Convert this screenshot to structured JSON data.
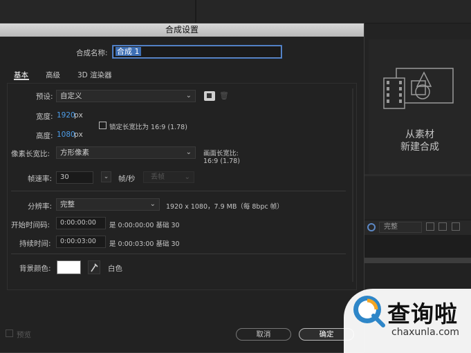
{
  "background": {
    "from_footage_line1": "从素材",
    "from_footage_line2": "新建合成",
    "quality": "完整"
  },
  "dialog": {
    "title": "合成设置",
    "name_label": "合成名称:",
    "name_value": "合成 1",
    "tabs": [
      "基本",
      "高级",
      "3D 渲染器"
    ],
    "preset_label": "预设:",
    "preset_value": "自定义",
    "width_label": "宽度:",
    "width_value": "1920",
    "width_unit": "px",
    "height_label": "高度:",
    "height_value": "1080",
    "height_unit": "px",
    "lock_aspect_label": "锁定长宽比为 16:9 (1.78)",
    "pixel_aspect_label": "像素长宽比:",
    "pixel_aspect_value": "方形像素",
    "frame_aspect_label": "画面长宽比:",
    "frame_aspect_value": "16:9 (1.78)",
    "fps_label": "帧速率:",
    "fps_value": "30",
    "fps_unit": "帧/秒",
    "drop_frame": "丢帧",
    "resolution_label": "分辨率:",
    "resolution_value": "完整",
    "resolution_info": "1920 x 1080，7.9 MB（每 8bpc 帧）",
    "start_timecode_label": "开始时间码:",
    "start_timecode_value": "0:00:00:00",
    "start_timecode_info": "是 0:00:00:00  基础 30",
    "duration_label": "持续时间:",
    "duration_value": "0:00:03:00",
    "duration_info": "是 0:00:03:00  基础 30",
    "bg_color_label": "背景颜色:",
    "bg_color_value": "#FFFFFF",
    "bg_color_name": "白色",
    "preview_label": "预览",
    "cancel_label": "取消",
    "ok_label": "确定"
  },
  "watermark": {
    "brand": "查询啦",
    "url": "chaxunla.com"
  },
  "colors": {
    "accent_blue": "#4d9de8",
    "dialog_bg": "#222222",
    "title_bar": "#c8c8c8"
  }
}
